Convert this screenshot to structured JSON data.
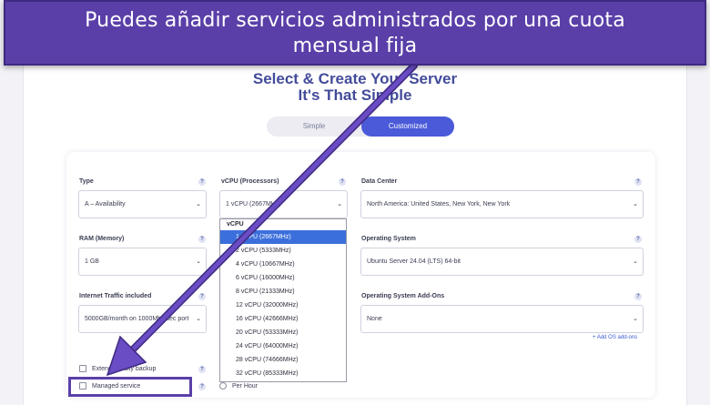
{
  "banner": {
    "line1": "Puedes añadir servicios administrados por una cuota",
    "line2": "mensual fija"
  },
  "page": {
    "headline_line1": "Select & Create Your Server",
    "headline_line2": "It's That Simple"
  },
  "mode_toggle": {
    "simple": "Simple",
    "customized": "Customized",
    "active": "customized"
  },
  "form": {
    "type": {
      "label": "Type",
      "value": "A – Availability"
    },
    "vcpu": {
      "label": "vCPU (Processors)",
      "value": "1 vCPU (2667MHz)"
    },
    "data_center": {
      "label": "Data Center",
      "value": "North America: United States, New York, New York"
    },
    "ram": {
      "label": "RAM (Memory)",
      "value": "1 GB"
    },
    "os": {
      "label": "Operating System",
      "value": "Ubuntu Server 24.04 (LTS) 64-bit"
    },
    "traffic": {
      "label": "Internet Traffic included",
      "value": "5000GB/month on 1000Mbit/sec port"
    },
    "os_addons": {
      "label": "Operating System Add-Ons",
      "value": "None"
    },
    "add_os_link": "+ Add OS add-ons",
    "help_glyph": "?"
  },
  "vcpu_dropdown": {
    "group": "vCPU",
    "options": [
      "1 vCPU (2667MHz)",
      "2 vCPU (5333MHz)",
      "4 vCPU (10667MHz)",
      "6 vCPU (16000MHz)",
      "8 vCPU (21333MHz)",
      "12 vCPU (32000MHz)",
      "16 vCPU (42666MHz)",
      "20 vCPU (53333MHz)",
      "24 vCPU (64000MHz)",
      "28 vCPU (74666MHz)",
      "32 vCPU (85333MHz)"
    ],
    "selected_index": 0
  },
  "checkboxes": {
    "daily_backup": "Extended daily backup",
    "managed_service": "Managed service",
    "per_hour": "Per Hour"
  },
  "colors": {
    "banner": "#5a3fa8",
    "accent": "#4a5ad8",
    "headline": "#434b9a",
    "selected_option": "#3b6fdb"
  }
}
